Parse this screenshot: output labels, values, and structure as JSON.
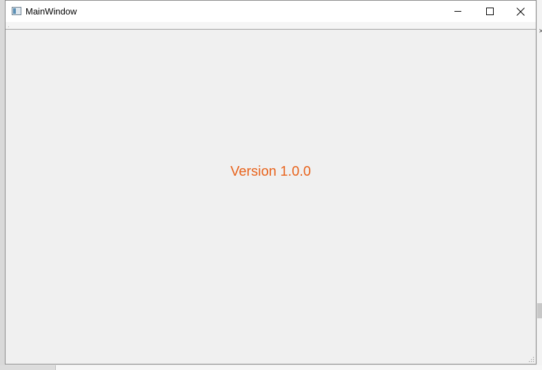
{
  "window": {
    "title": "MainWindow",
    "app_icon": "window-app-icon",
    "controls": {
      "minimize": "minimize-icon",
      "maximize": "maximize-icon",
      "close": "close-icon"
    }
  },
  "content": {
    "version_text": "Version 1.0.0",
    "version_color": "#e8631c"
  }
}
